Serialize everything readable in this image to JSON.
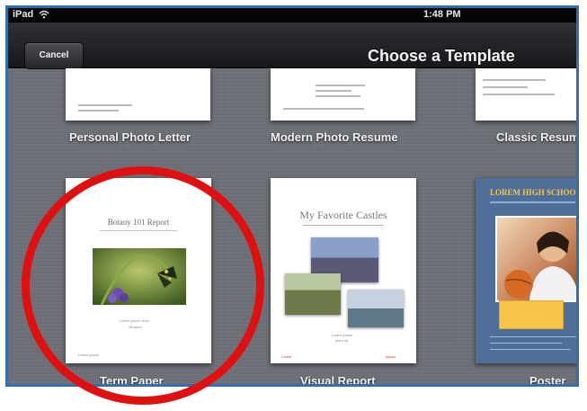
{
  "status_bar": {
    "device": "iPad",
    "time": "1:48 PM",
    "wifi_icon": "wifi-icon"
  },
  "nav": {
    "cancel_label": "Cancel",
    "title": "Choose a Template"
  },
  "templates_row1": [
    {
      "label": "Personal Photo Letter"
    },
    {
      "label": "Modern Photo Resume"
    },
    {
      "label": "Classic Resume"
    }
  ],
  "templates_row2": [
    {
      "label": "Term Paper",
      "doc_title": "Botany 101 Report",
      "highlighted": true
    },
    {
      "label": "Visual Report",
      "doc_title": "My Favorite Castles"
    },
    {
      "label": "Poster",
      "doc_title": "LOREM HIGH SCHOOL"
    }
  ],
  "colors": {
    "highlight_ring": "#e01010",
    "frame_border": "#2f6fb0",
    "poster_bg": "#4f6f98",
    "poster_title": "#f6c54a"
  }
}
